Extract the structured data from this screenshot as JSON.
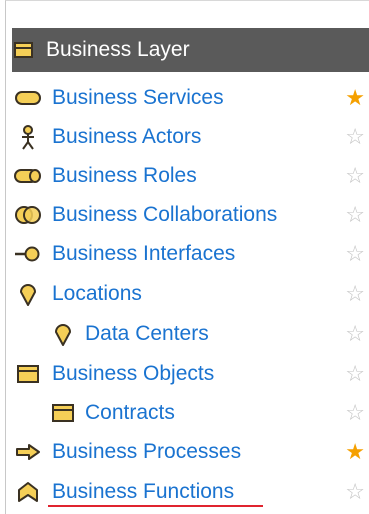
{
  "header": {
    "title": "Business Layer",
    "icon": "business-object-icon"
  },
  "items": [
    {
      "label": "Business Services",
      "icon": "service-icon",
      "starred": true,
      "indent": 0
    },
    {
      "label": "Business Actors",
      "icon": "actor-icon",
      "starred": false,
      "indent": 0
    },
    {
      "label": "Business Roles",
      "icon": "role-icon",
      "starred": false,
      "indent": 0
    },
    {
      "label": "Business Collaborations",
      "icon": "collaboration-icon",
      "starred": false,
      "indent": 0
    },
    {
      "label": "Business Interfaces",
      "icon": "interface-icon",
      "starred": false,
      "indent": 0
    },
    {
      "label": "Locations",
      "icon": "location-icon",
      "starred": false,
      "indent": 0
    },
    {
      "label": "Data Centers",
      "icon": "location-icon",
      "starred": false,
      "indent": 1
    },
    {
      "label": "Business Objects",
      "icon": "business-object-icon",
      "starred": false,
      "indent": 0
    },
    {
      "label": "Contracts",
      "icon": "business-object-icon",
      "starred": false,
      "indent": 1
    },
    {
      "label": "Business Processes",
      "icon": "process-icon",
      "starred": true,
      "indent": 0
    },
    {
      "label": "Business Functions",
      "icon": "function-icon",
      "starred": false,
      "indent": 0
    }
  ],
  "colors": {
    "link": "#1a73d0",
    "header_bg": "#5a5a5a",
    "star_filled": "#f5a000",
    "star_empty": "#c4c4c4",
    "icon_fill": "#f5cf57",
    "selected_underline": "#e0242f"
  },
  "glyphs": {
    "star_filled": "★",
    "star_empty": "☆"
  }
}
